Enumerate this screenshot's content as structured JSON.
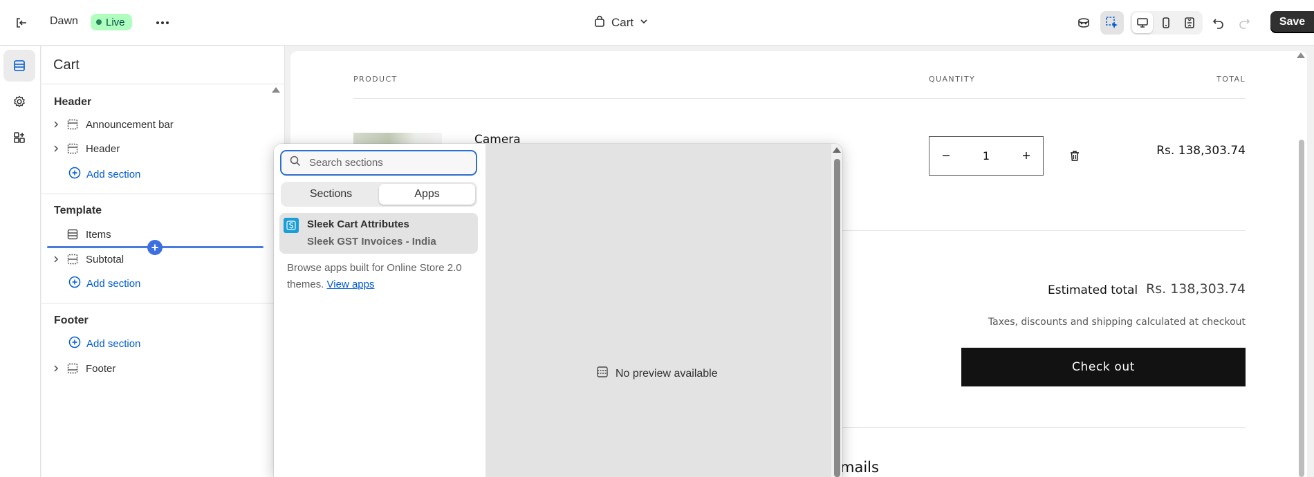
{
  "topbar": {
    "theme_name": "Dawn",
    "live_label": "Live",
    "page_label": "Cart",
    "save_label": "Save"
  },
  "sidebar": {
    "title": "Cart",
    "header_group": "Header",
    "header_items": [
      "Announcement bar",
      "Header"
    ],
    "add_section": "Add section",
    "template_group": "Template",
    "template_items": [
      "Items",
      "Subtotal"
    ],
    "footer_group": "Footer",
    "footer_items": [
      "Footer"
    ]
  },
  "canvas": {
    "col_product": "PRODUCT",
    "col_quantity": "QUANTITY",
    "col_total": "TOTAL",
    "product_name": "Camera",
    "quantity": "1",
    "price": "Rs. 138,303.74",
    "estimated_label": "Estimated total",
    "estimated_value": "Rs. 138,303.74",
    "tax_note": "Taxes, discounts and shipping calculated at checkout",
    "checkout_label": "Check out",
    "partial_heading": "mails"
  },
  "popover": {
    "search_placeholder": "Search sections",
    "tab_sections": "Sections",
    "tab_apps": "Apps",
    "app_title": "Sleek Cart Attributes",
    "app_subtitle": "Sleek GST Invoices - India",
    "browse_text": "Browse apps built for Online Store 2.0 themes.",
    "view_apps_link": "View apps",
    "no_preview": "No preview available"
  },
  "colors": {
    "accent": "#005bd3",
    "live_bg": "#affebf",
    "checkout_bg": "#121212",
    "insert_line": "#4a7bdc"
  }
}
